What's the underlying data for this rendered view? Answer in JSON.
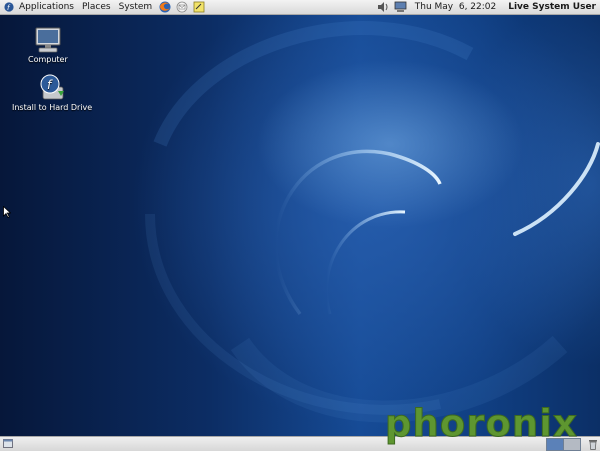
{
  "top_panel": {
    "menus": [
      "Applications",
      "Places",
      "System"
    ],
    "launchers": [
      "firefox-icon",
      "mail-icon",
      "notes-icon"
    ],
    "tray": [
      "volume-icon",
      "network-icon"
    ],
    "clock": "Thu May  6, 22:02",
    "user": "Live System User"
  },
  "desktop": {
    "icons": [
      {
        "label": "Computer",
        "icon": "computer-icon"
      },
      {
        "label": "Install to Hard Drive",
        "icon": "install-icon"
      }
    ]
  },
  "bottom_panel": {
    "workspaces": 2,
    "active_workspace": 1
  },
  "watermark": "phoronix",
  "colors": {
    "accent": "#5e9630",
    "panel": "#e6e6e6",
    "wallpaper": "#164b96"
  }
}
